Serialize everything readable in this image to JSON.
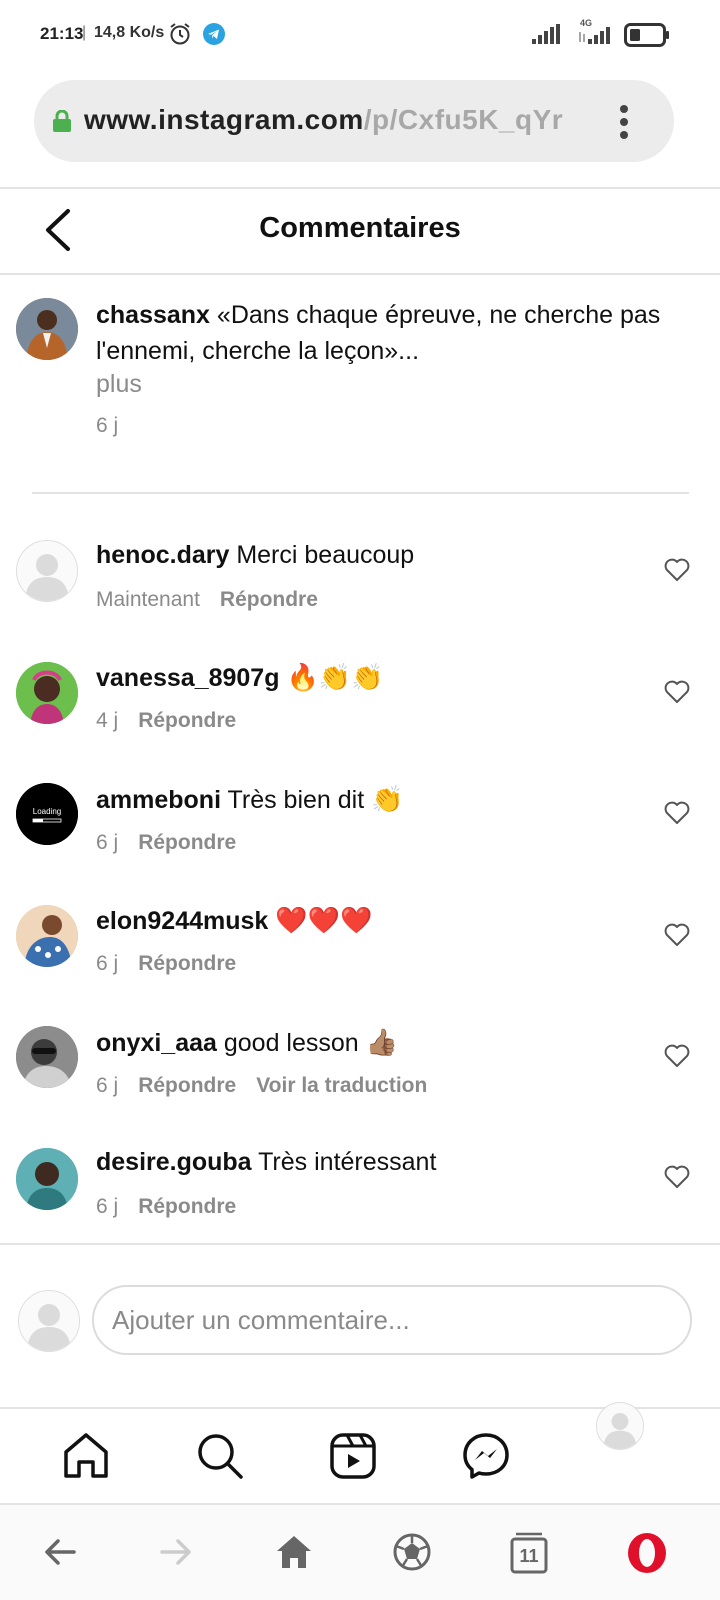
{
  "status_bar": {
    "time": "21:13",
    "speed": "14,8 Ko/s",
    "network": "4G"
  },
  "browser": {
    "url_host": "www.instagram.com",
    "url_path": "/p/Cxfu5K_qYr",
    "tabs_count": "11"
  },
  "header": {
    "title": "Commentaires"
  },
  "caption": {
    "username": "chassanx",
    "text": "«Dans chaque épreuve, ne cherche pas l'ennemi, cherche la leçon»...",
    "more": "plus",
    "time": "6 j"
  },
  "comments": [
    {
      "username": "henoc.dary",
      "text": "Merci beaucoup",
      "emoji": "",
      "time": "Maintenant",
      "reply": "Répondre",
      "translate": ""
    },
    {
      "username": "vanessa_8907g",
      "text": "",
      "emoji": "🔥👏👏",
      "time": "4 j",
      "reply": "Répondre",
      "translate": ""
    },
    {
      "username": "ammeboni",
      "text": "Très bien dit",
      "emoji": "👏",
      "time": "6 j",
      "reply": "Répondre",
      "translate": ""
    },
    {
      "username": "elon9244musk",
      "text": "",
      "emoji": "❤️❤️❤️",
      "time": "6 j",
      "reply": "Répondre",
      "translate": ""
    },
    {
      "username": "onyxi_aaa",
      "text": "good lesson",
      "emoji": "👍🏽",
      "time": "6 j",
      "reply": "Répondre",
      "translate": "Voir la traduction"
    },
    {
      "username": "desire.gouba",
      "text": "Très intéressant",
      "emoji": "",
      "time": "6 j",
      "reply": "Répondre",
      "translate": ""
    }
  ],
  "composer": {
    "placeholder": "Ajouter un commentaire..."
  },
  "avatar_labels": {
    "ammeboni": "Loading"
  },
  "icons": {
    "nav": [
      "home-icon",
      "search-icon",
      "reels-icon",
      "messenger-icon",
      "profile-avatar"
    ],
    "browser_nav": [
      "back-arrow-icon",
      "forward-arrow-icon",
      "home-icon",
      "speed-dial-icon",
      "tabs-icon",
      "opera-menu-icon"
    ]
  },
  "colors": {
    "lock_green": "#4caf50",
    "telegram_blue": "#2aa3e0",
    "opera_red": "#e0102b",
    "meta_gray": "#8a8a8a"
  }
}
